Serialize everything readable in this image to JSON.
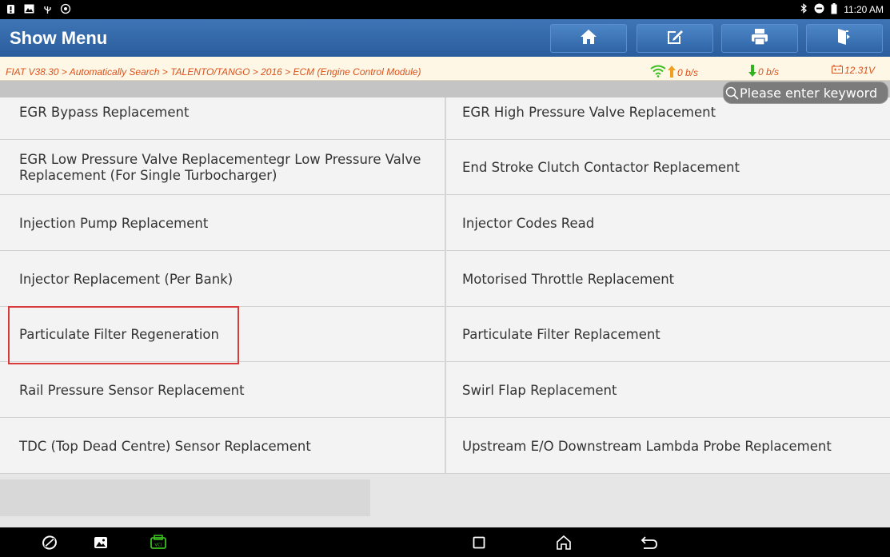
{
  "status_bar": {
    "time": "11:20 AM",
    "icons": [
      "notification-icon",
      "image-icon",
      "usb-icon",
      "settings-icon",
      "bluetooth-icon",
      "minus-circle-icon",
      "battery-icon"
    ]
  },
  "header": {
    "title": "Show Menu",
    "buttons": [
      "home-icon",
      "edit-icon",
      "print-icon",
      "exit-icon"
    ]
  },
  "breadcrumb": {
    "text": "FIAT V38.30 > Automatically Search > TALENTO/TANGO > 2016 > ECM (Engine Control Module)",
    "upload_rate": "0 b/s",
    "download_rate": "0 b/s",
    "voltage": "12.31V"
  },
  "search": {
    "placeholder": "Please enter keyword"
  },
  "menu": {
    "items": [
      {
        "label": "EGR Bypass Replacement"
      },
      {
        "label": "EGR High Pressure Valve Replacement"
      },
      {
        "label": "EGR Low Pressure Valve Replacementegr Low Pressure Valve Replacement (For Single Turbocharger)"
      },
      {
        "label": "End Stroke Clutch Contactor Replacement"
      },
      {
        "label": "Injection Pump Replacement"
      },
      {
        "label": "Injector Codes Read"
      },
      {
        "label": "Injector Replacement (Per Bank)"
      },
      {
        "label": "Motorised Throttle Replacement"
      },
      {
        "label": "Particulate Filter Regeneration"
      },
      {
        "label": "Particulate Filter Replacement"
      },
      {
        "label": "Rail Pressure Sensor Replacement"
      },
      {
        "label": "Swirl Flap Replacement"
      },
      {
        "label": "TDC (Top Dead Centre) Sensor Replacement"
      },
      {
        "label": "Upstream E/O Downstream Lambda Probe Replacement"
      }
    ]
  },
  "nav_bar": {
    "icons": [
      "browser-icon",
      "gallery-icon",
      "vci-icon",
      "recents-icon",
      "home-icon",
      "back-icon"
    ]
  },
  "colors": {
    "header_blue": "#2f64a5",
    "breadcrumb_text": "#d9531e",
    "highlight_red": "#d93a3a",
    "wifi_green": "#3bbf1e",
    "arrow_up": "#f0a020",
    "arrow_down": "#2fb31e"
  }
}
